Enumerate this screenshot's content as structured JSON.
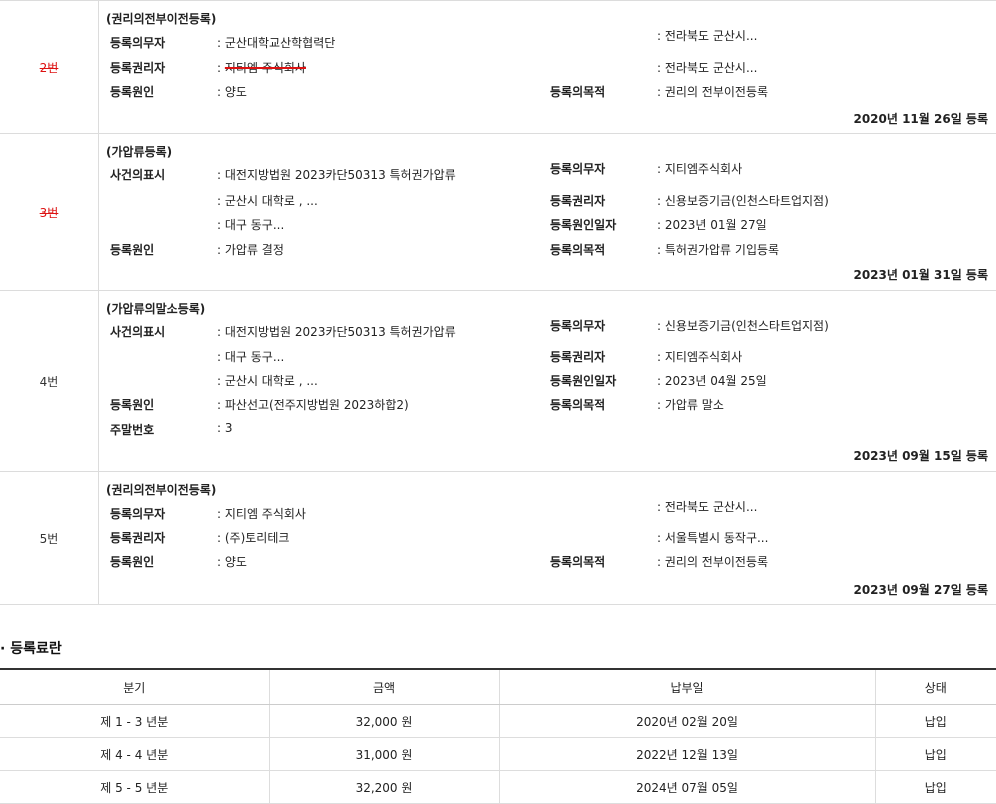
{
  "entries": [
    {
      "number": "2번",
      "struck": true,
      "kind": "(권리의전부이전등록)",
      "obligor_label": "등록의무자",
      "obligor": "군산대학교산학협력단",
      "obligor_addr": ": 전라북도 군산시...",
      "holder_label": "등록권리자",
      "holder": "지티엠 주식회사",
      "holder_addr": ": 전라북도 군산시...",
      "cause_label": "등록원인",
      "cause": "양도",
      "purpose_label": "등록의목적",
      "purpose": ": 권리의 전부이전등록",
      "date": "2020년 11월 26일 등록"
    },
    {
      "number": "3번",
      "struck": true,
      "kind": "(가압류등록)",
      "case_label": "사건의표시",
      "case": ": 대전지방법원 2023카단50313 특허권가압류",
      "addr1": ": 군산시 대학로 , ...",
      "addr2": ": 대구 동구...",
      "cause_label": "등록원인",
      "cause": ": 가압류 결정",
      "r_obligor_label": "등록의무자",
      "r_obligor": ": 지티엠주식회사",
      "r_holder_label": "등록권리자",
      "r_holder": ": 신용보증기금(인천스타트업지점)",
      "r_causedate_label": "등록원인일자",
      "r_causedate": ": 2023년 01월 27일",
      "r_purpose_label": "등록의목적",
      "r_purpose": ": 특허권가압류 기입등록",
      "date": "2023년 01월 31일 등록"
    },
    {
      "number": "4번",
      "struck": false,
      "kind": "(가압류의말소등록)",
      "case_label": "사건의표시",
      "case": ": 대전지방법원 2023카단50313 특허권가압류",
      "addr1": ": 대구 동구...",
      "addr2": ": 군산시 대학로 , ...",
      "cause_label": "등록원인",
      "cause": ": 파산선고(전주지방법원 2023하합2)",
      "closing_label": "주말번호",
      "closing": ": 3",
      "r_obligor_label": "등록의무자",
      "r_obligor": ": 신용보증기금(인천스타트업지점)",
      "r_holder_label": "등록권리자",
      "r_holder": ": 지티엠주식회사",
      "r_causedate_label": "등록원인일자",
      "r_causedate": ": 2023년 04월 25일",
      "r_purpose_label": "등록의목적",
      "r_purpose": ": 가압류 말소",
      "date": "2023년 09월 15일 등록"
    },
    {
      "number": "5번",
      "struck": false,
      "kind": "(권리의전부이전등록)",
      "obligor_label": "등록의무자",
      "obligor": ": 지티엠 주식회사",
      "obligor_addr": ": 전라북도 군산시...",
      "holder_label": "등록권리자",
      "holder": ": (주)토리테크",
      "holder_addr": ": 서울특별시 동작구...",
      "cause_label": "등록원인",
      "cause": ": 양도",
      "purpose_label": "등록의목적",
      "purpose": ": 권리의 전부이전등록",
      "date": "2023년 09월 27일 등록"
    }
  ],
  "e2_prefix": ":",
  "fee_section": {
    "title": "· 등록료란",
    "headers": [
      "분기",
      "금액",
      "납부일",
      "상태"
    ],
    "rows": [
      [
        "제 1 - 3 년분",
        "32,000 원",
        "2020년 02월 20일",
        "납입"
      ],
      [
        "제 4 - 4 년분",
        "31,000 원",
        "2022년 12월 13일",
        "납입"
      ],
      [
        "제 5 - 5 년분",
        "32,200 원",
        "2024년 07월 05일",
        "납입"
      ]
    ]
  },
  "colors": {
    "strike": "#dd1111",
    "border": "#dcdcdc"
  }
}
